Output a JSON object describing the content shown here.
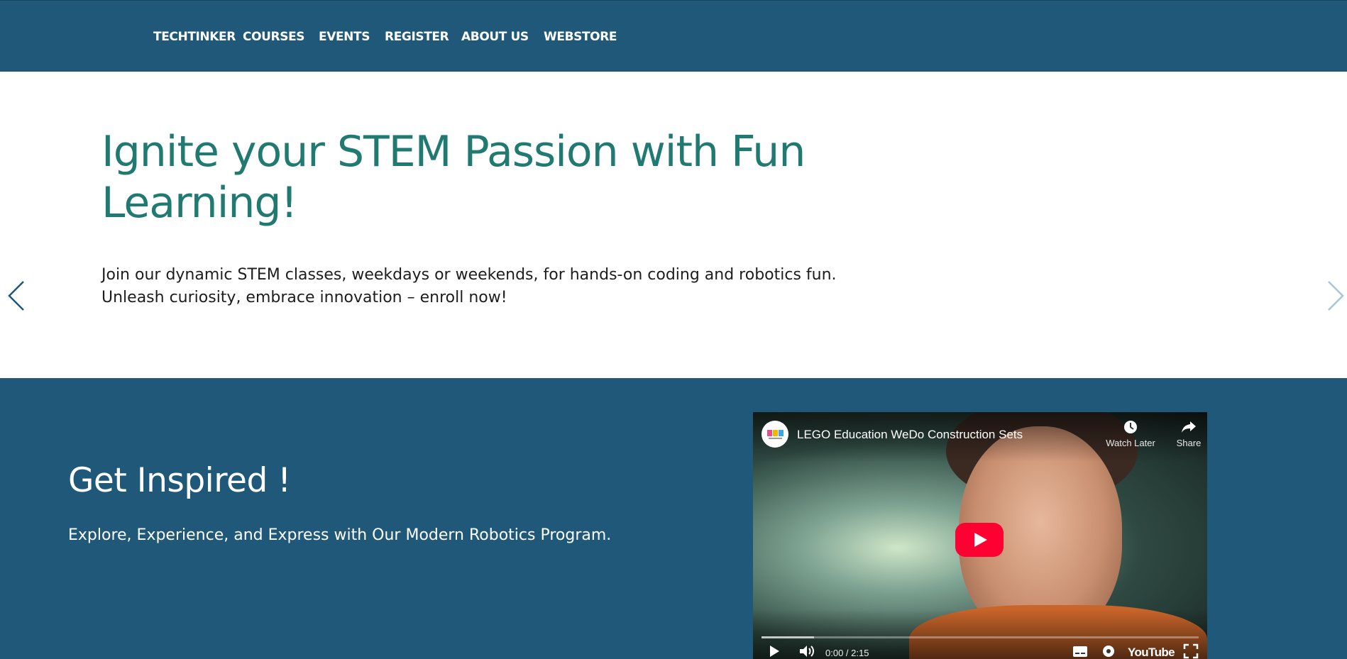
{
  "nav": {
    "brand": "TECHTINKER",
    "items": [
      {
        "label": "COURSES"
      },
      {
        "label": "EVENTS"
      },
      {
        "label": "REGISTER"
      },
      {
        "label": "ABOUT US"
      },
      {
        "label": "WEBSTORE"
      }
    ]
  },
  "hero": {
    "title": "Ignite your STEM Passion with Fun Learning!",
    "body_line1": "Join our dynamic STEM classes, weekdays or weekends, for hands-on coding and robotics fun.",
    "body_line2": "Unleash curiosity, embrace innovation – enroll now!",
    "prev_icon": "chevron-left-icon",
    "next_icon": "chevron-right-icon",
    "slide_count": 2,
    "active_slide": 2
  },
  "inspire": {
    "title": "Get Inspired !",
    "subtitle": "Explore, Experience, and Express with Our Modern Robotics Program."
  },
  "video": {
    "title": "LEGO Education WeDo Construction Sets",
    "watch_later": "Watch Later",
    "share": "Share",
    "time": "0:00 / 2:15",
    "brand": "YouTube",
    "buffered_fraction": 0.12
  },
  "colors": {
    "header_bg": "#1f5878",
    "hero_title": "#217a72",
    "dot_active": "#1a73e8",
    "dot_inactive": "#c8c8c8",
    "play_red": "#ff0033"
  }
}
